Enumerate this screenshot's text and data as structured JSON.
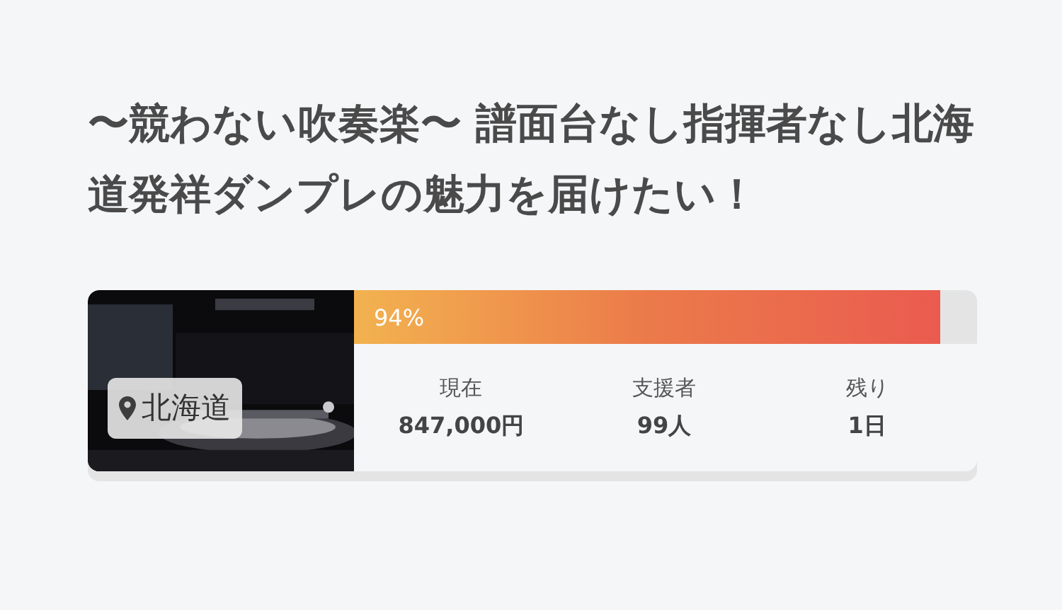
{
  "title": "〜競わない吹奏楽〜 譜面台なし指揮者なし北海道発祥ダンプレの魅力を届けたい！",
  "card": {
    "location": "北海道",
    "progress": {
      "level": 0.94,
      "label": "94%"
    },
    "stats": [
      {
        "label": "現在",
        "value": "847,000円"
      },
      {
        "label": "支援者",
        "value": "99人"
      },
      {
        "label": "残り",
        "value": "1日"
      }
    ]
  }
}
